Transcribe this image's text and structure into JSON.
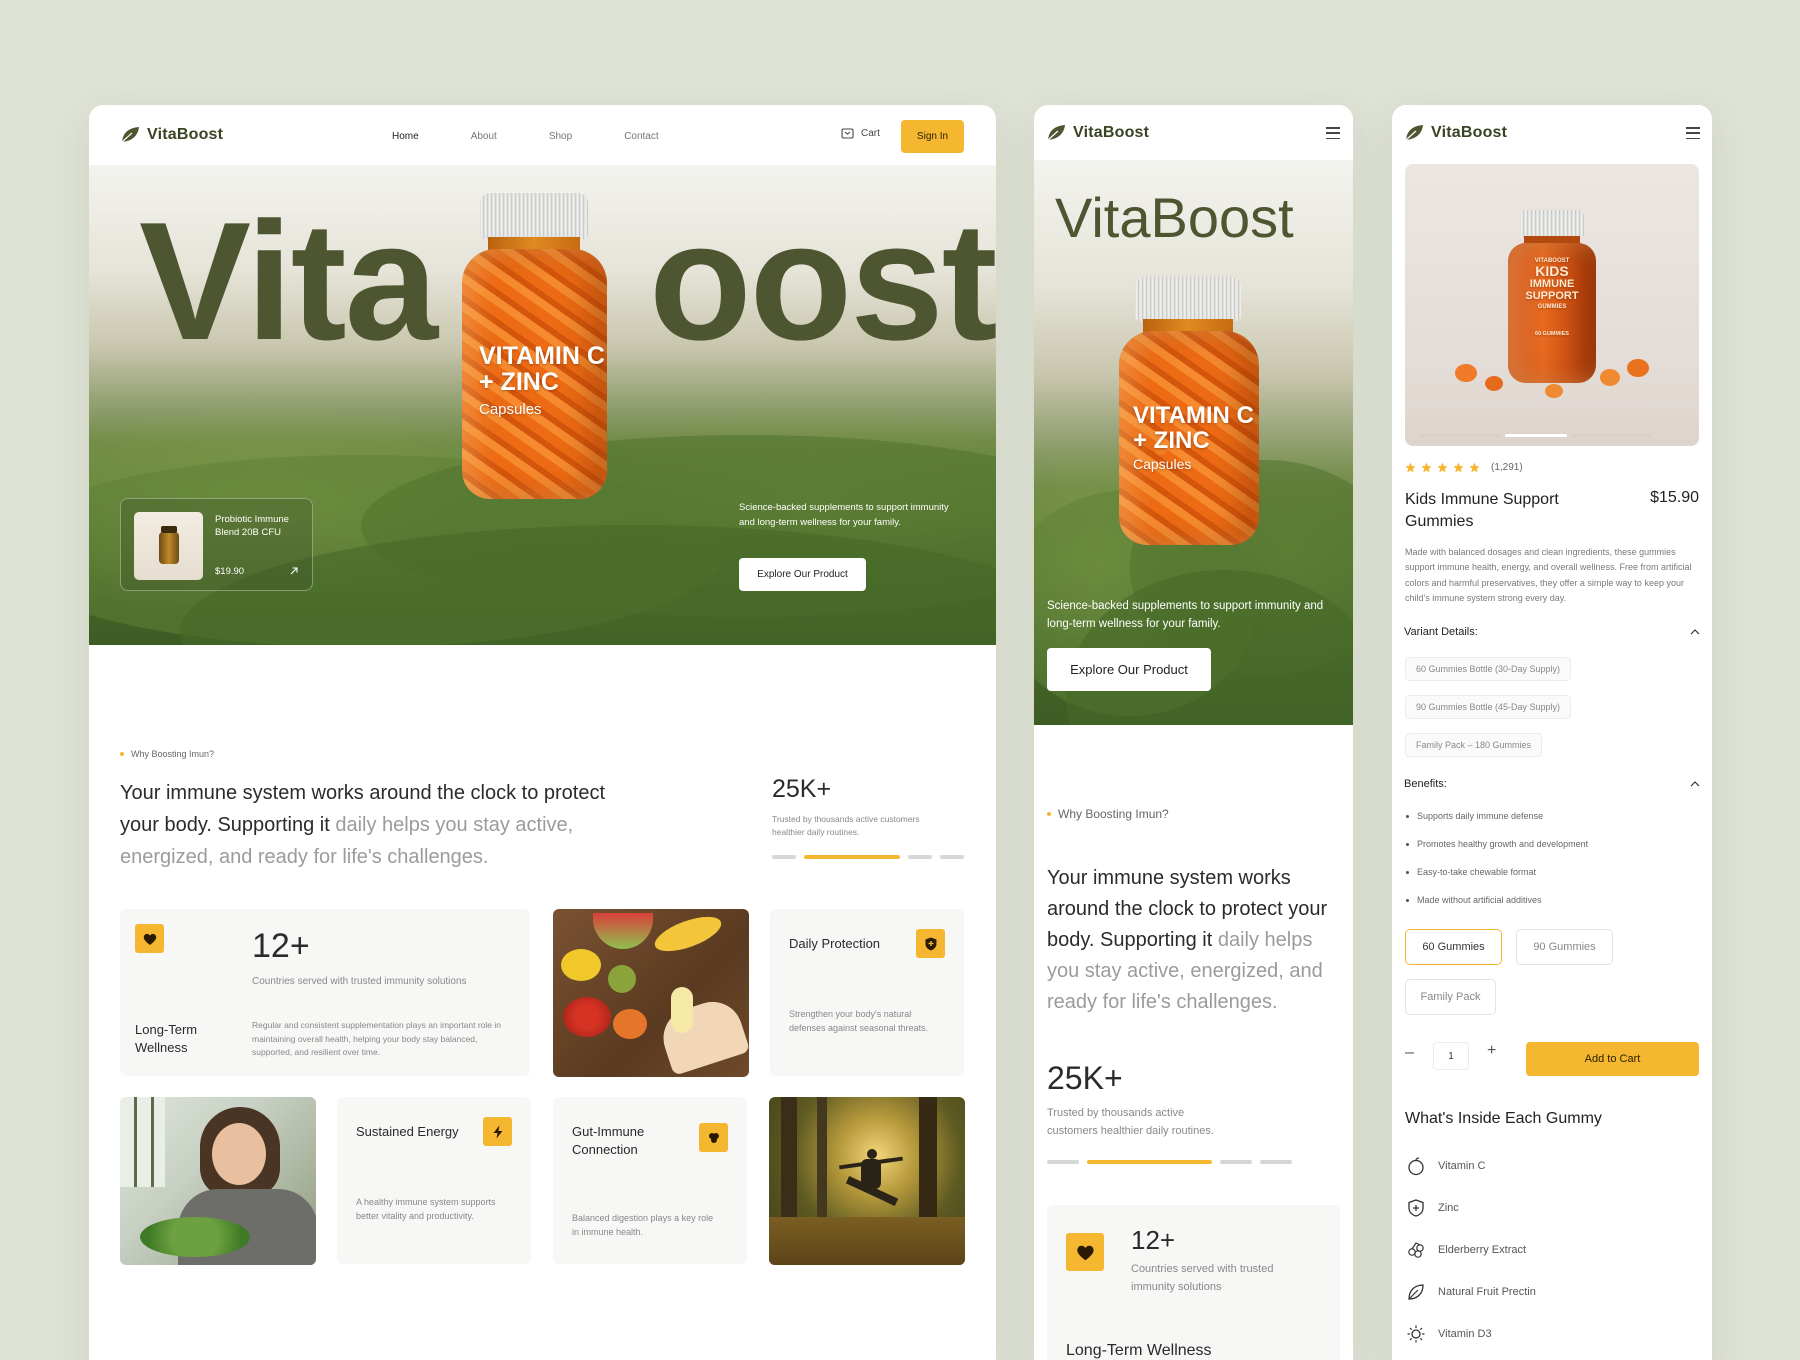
{
  "brand": "VitaBoost",
  "desktop": {
    "nav": [
      "Home",
      "About",
      "Shop",
      "Contact"
    ],
    "cart_label": "Cart",
    "signin_label": "Sign In",
    "hero_word_left": "Vita",
    "hero_word_right": "oost",
    "jar_label": {
      "line1": "VITAMIN C",
      "line2": "+ ZINC",
      "line3": "Capsules"
    },
    "mini_product": {
      "name": "Probiotic Immune Blend 20B CFU",
      "price": "$19.90"
    },
    "hero_text": "Science-backed supplements to support immunity and long-term wellness for your family.",
    "cta": "Explore Our Product",
    "eyebrow": "Why Boosting Imun?",
    "statement_dark": "Your immune system works around the clock to protect your body. Supporting it",
    "statement_light": "daily helps you stay active, energized, and ready for life's challenges.",
    "stat_value": "25K+",
    "stat_text": "Trusted by thousands active customers healthier daily routines.",
    "tile_wellness": {
      "value": "12+",
      "value_text": "Countries served with trusted immunity solutions",
      "title": "Long-Term Wellness",
      "body": "Regular and consistent supplementation plays an important role in maintaining overall health, helping your body stay balanced, supported, and resilient over time."
    },
    "tile_daily": {
      "title": "Daily Protection",
      "body": "Strengthen your body's natural defenses against seasonal threats."
    },
    "tile_energy": {
      "title": "Sustained Energy",
      "body": "A healthy immune system supports better vitality and productivity."
    },
    "tile_gut": {
      "title": "Gut-Immune Connection",
      "body": "Balanced digestion plays a key role in immune health."
    }
  },
  "mobile": {
    "hero_word": "VitaBoost",
    "jar_label": {
      "line1": "VITAMIN C",
      "line2": "+ ZINC",
      "line3": "Capsules"
    },
    "hero_text": "Science-backed supplements to support immunity and long-term wellness for your family.",
    "cta": "Explore Our Product",
    "eyebrow": "Why Boosting Imun?",
    "statement_dark": "Your immune system works around the clock to protect your body. Supporting it",
    "statement_light": "daily helps you stay active, energized, and ready for life's challenges.",
    "stat_value": "25K+",
    "stat_text": "Trusted by thousands active customers healthier daily routines.",
    "tile_value": "12+",
    "tile_value_text": "Countries served with trusted immunity solutions",
    "tile_title": "Long-Term Wellness"
  },
  "product": {
    "jar_label": {
      "brand": "VITABOOST",
      "line1": "KIDS",
      "line2": "IMMUNE",
      "line3": "SUPPORT",
      "line4": "GUMMIES",
      "line5": "60 GUMMIES"
    },
    "rating": 5,
    "reviews": "(1,291)",
    "name": "Kids Immune Support Gummies",
    "price": "$15.90",
    "description": "Made with balanced dosages and clean ingredients, these gummies support immune health, energy, and overall wellness. Free from artificial colors and harmful preservatives, they offer a simple way to keep your child's immune system strong every day.",
    "variant_heading": "Variant Details:",
    "variants": [
      "60 Gummies Bottle (30-Day Supply)",
      "90 Gummies Bottle (45-Day Supply)",
      "Family Pack – 180 Gummies"
    ],
    "benefits_heading": "Benefits:",
    "benefits": [
      "Supports daily immune defense",
      "Promotes healthy growth and development",
      "Easy-to-take chewable format",
      "Made without artificial additives"
    ],
    "options": [
      "60 Gummies",
      "90 Gummies",
      "Family Pack"
    ],
    "quantity": "1",
    "add_to_cart": "Add to Cart",
    "inside_heading": "What's Inside Each Gummy",
    "ingredients": [
      {
        "name": "Vitamin C",
        "icon": "orange-icon"
      },
      {
        "name": "Zinc",
        "icon": "shield-plus-icon"
      },
      {
        "name": "Elderberry Extract",
        "icon": "berries-icon"
      },
      {
        "name": "Natural Fruit Prectin",
        "icon": "leaf-icon"
      },
      {
        "name": "Vitamin D3",
        "icon": "sun-icon"
      }
    ]
  },
  "colors": {
    "accent": "#f5b630",
    "brand_dark": "#4d5631",
    "background": "#dfe3d6"
  }
}
